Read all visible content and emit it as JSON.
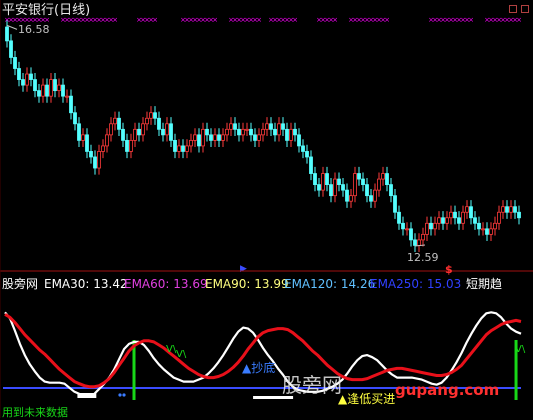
{
  "colors": {
    "background": "#000000",
    "up": "#ff3b3b",
    "down": "#54ffff",
    "magenta_x": "#ff00ff",
    "white": "#ffffff",
    "red": "#e8101a",
    "green": "#18d818",
    "blue": "#3a4cff",
    "label_blue": "#3a7cff",
    "divider": "#a01010",
    "ema30": "#ffffff",
    "ema60": "#e040e0",
    "ema90": "#ffff80",
    "ema120": "#60c0ff",
    "ema250": "#3040ff"
  },
  "header": {
    "title": "平安银行(日线)"
  },
  "price_labels": {
    "high": "16.58",
    "low": "12.59"
  },
  "markers": {
    "dollar": "$"
  },
  "indicator": {
    "name": "股旁网",
    "ema30": "EMA30: 13.42",
    "ema60": "EMA60: 13.69",
    "ema90": "EMA90: 13.99",
    "ema120": "EMA120: 14.26",
    "ema250": "EMA250: 15.03",
    "short_trend": "短期趋",
    "tag_bottom": "抄底",
    "tag_entry": "逢低买进",
    "tag_v1": "V\\",
    "tag_v2": "V\\",
    "tag_v3": "V\\"
  },
  "watermark": {
    "text": "股旁网",
    "url": "gupang.com"
  },
  "footer": {
    "text": "用到未来数据"
  },
  "chart_data": [
    {
      "type": "candlestick",
      "title": "平安银行(日线)",
      "x": [
        1,
        2,
        3,
        4,
        5,
        6,
        7,
        8,
        9,
        10,
        11,
        12,
        13,
        14,
        15,
        16,
        17,
        18,
        19,
        20,
        21,
        22,
        23,
        24,
        25,
        26,
        27,
        28,
        29,
        30,
        31,
        32,
        33,
        34,
        35,
        36,
        37,
        38,
        39,
        40,
        41,
        42,
        43,
        44,
        45,
        46,
        47,
        48,
        49,
        50,
        51,
        52,
        53,
        54,
        55,
        56,
        57,
        58,
        59,
        60,
        61,
        62,
        63,
        64,
        65,
        66,
        67,
        68,
        69,
        70,
        71,
        72,
        73,
        74,
        75,
        76,
        77,
        78,
        79,
        80,
        81,
        82,
        83,
        84,
        85,
        86,
        87,
        88,
        89,
        90,
        91,
        92,
        93,
        94,
        95,
        96,
        97,
        98,
        99,
        100,
        101,
        102,
        103,
        104,
        105,
        106,
        107,
        108,
        109,
        110,
        111,
        112,
        113,
        114,
        115,
        116,
        117,
        118,
        119,
        120,
        121,
        122,
        123,
        124,
        125,
        126,
        127,
        128,
        129
      ],
      "close": [
        16.3,
        16.0,
        15.8,
        15.6,
        15.5,
        15.7,
        15.6,
        15.4,
        15.3,
        15.5,
        15.3,
        15.6,
        15.4,
        15.5,
        15.3,
        15.3,
        15.0,
        14.8,
        14.5,
        14.6,
        14.3,
        14.2,
        14.0,
        14.3,
        14.4,
        14.6,
        14.8,
        14.9,
        14.7,
        14.5,
        14.3,
        14.5,
        14.7,
        14.6,
        14.8,
        14.9,
        15.0,
        14.9,
        14.7,
        14.6,
        14.8,
        14.5,
        14.3,
        14.4,
        14.3,
        14.4,
        14.5,
        14.6,
        14.4,
        14.7,
        14.6,
        14.5,
        14.6,
        14.5,
        14.6,
        14.7,
        14.8,
        14.7,
        14.6,
        14.7,
        14.7,
        14.6,
        14.5,
        14.6,
        14.7,
        14.8,
        14.7,
        14.6,
        14.8,
        14.7,
        14.5,
        14.7,
        14.6,
        14.4,
        14.3,
        14.2,
        13.9,
        13.7,
        13.6,
        13.9,
        13.7,
        13.5,
        13.8,
        13.7,
        13.6,
        13.4,
        13.5,
        13.9,
        13.8,
        13.7,
        13.5,
        13.4,
        13.6,
        13.8,
        13.9,
        13.7,
        13.5,
        13.2,
        13.0,
        12.9,
        12.9,
        12.7,
        12.6,
        12.7,
        12.8,
        13.0,
        12.9,
        13.0,
        13.1,
        13.0,
        13.1,
        13.2,
        13.1,
        13.0,
        13.2,
        13.3,
        13.1,
        13.0,
        12.9,
        12.9,
        12.8,
        12.9,
        13.0,
        13.2,
        13.3,
        13.2,
        13.3,
        13.2,
        13.1
      ],
      "y_range": [
        12.3,
        16.75
      ],
      "annotations": {
        "high": 16.58,
        "low": 12.59
      }
    },
    {
      "type": "line",
      "series": [
        {
          "name": "white",
          "values": [
            86,
            80,
            68,
            55,
            44,
            35,
            28,
            22,
            18,
            17,
            17,
            17,
            16,
            12,
            8,
            6,
            4,
            4,
            6,
            11,
            16,
            22,
            30,
            40,
            50,
            55,
            57,
            57,
            54,
            48,
            41,
            35,
            30,
            26,
            22,
            20,
            18,
            18,
            18,
            20,
            22,
            26,
            31,
            37,
            44,
            52,
            60,
            67,
            71,
            70,
            66,
            59,
            51,
            44,
            38,
            31,
            25,
            18,
            13,
            10,
            9,
            8,
            8,
            8,
            9,
            11,
            13,
            16,
            20,
            26,
            33,
            39,
            43,
            44,
            42,
            39,
            34,
            29,
            25,
            22,
            22,
            22,
            22,
            21,
            20,
            18,
            16,
            15,
            17,
            22,
            29,
            37,
            46,
            56,
            65,
            73,
            80,
            85,
            86,
            85,
            81,
            75,
            70,
            67,
            65
          ]
        },
        {
          "name": "red",
          "values": [
            84,
            81,
            76,
            70,
            64,
            59,
            54,
            49,
            45,
            40,
            35,
            30,
            26,
            22,
            18,
            16,
            14,
            13,
            13,
            14,
            17,
            21,
            27,
            34,
            41,
            48,
            53,
            56,
            58,
            58,
            57,
            54,
            51,
            47,
            43,
            39,
            35,
            31,
            28,
            25,
            23,
            22,
            22,
            23,
            25,
            28,
            32,
            37,
            43,
            50,
            56,
            62,
            66,
            68,
            69,
            70,
            70,
            69,
            66,
            62,
            58,
            53,
            48,
            44,
            39,
            34,
            30,
            26,
            23,
            21,
            20,
            20,
            20,
            21,
            23,
            25,
            27,
            29,
            30,
            31,
            31,
            30,
            29,
            28,
            27,
            26,
            25,
            24,
            24,
            25,
            27,
            30,
            34,
            40,
            46,
            52,
            58,
            64,
            68,
            71,
            74,
            76,
            77,
            78,
            77
          ]
        }
      ],
      "signal_bars": [
        26,
        103
      ],
      "bottom_threshold": 7,
      "y_range": [
        0,
        100
      ]
    }
  ]
}
